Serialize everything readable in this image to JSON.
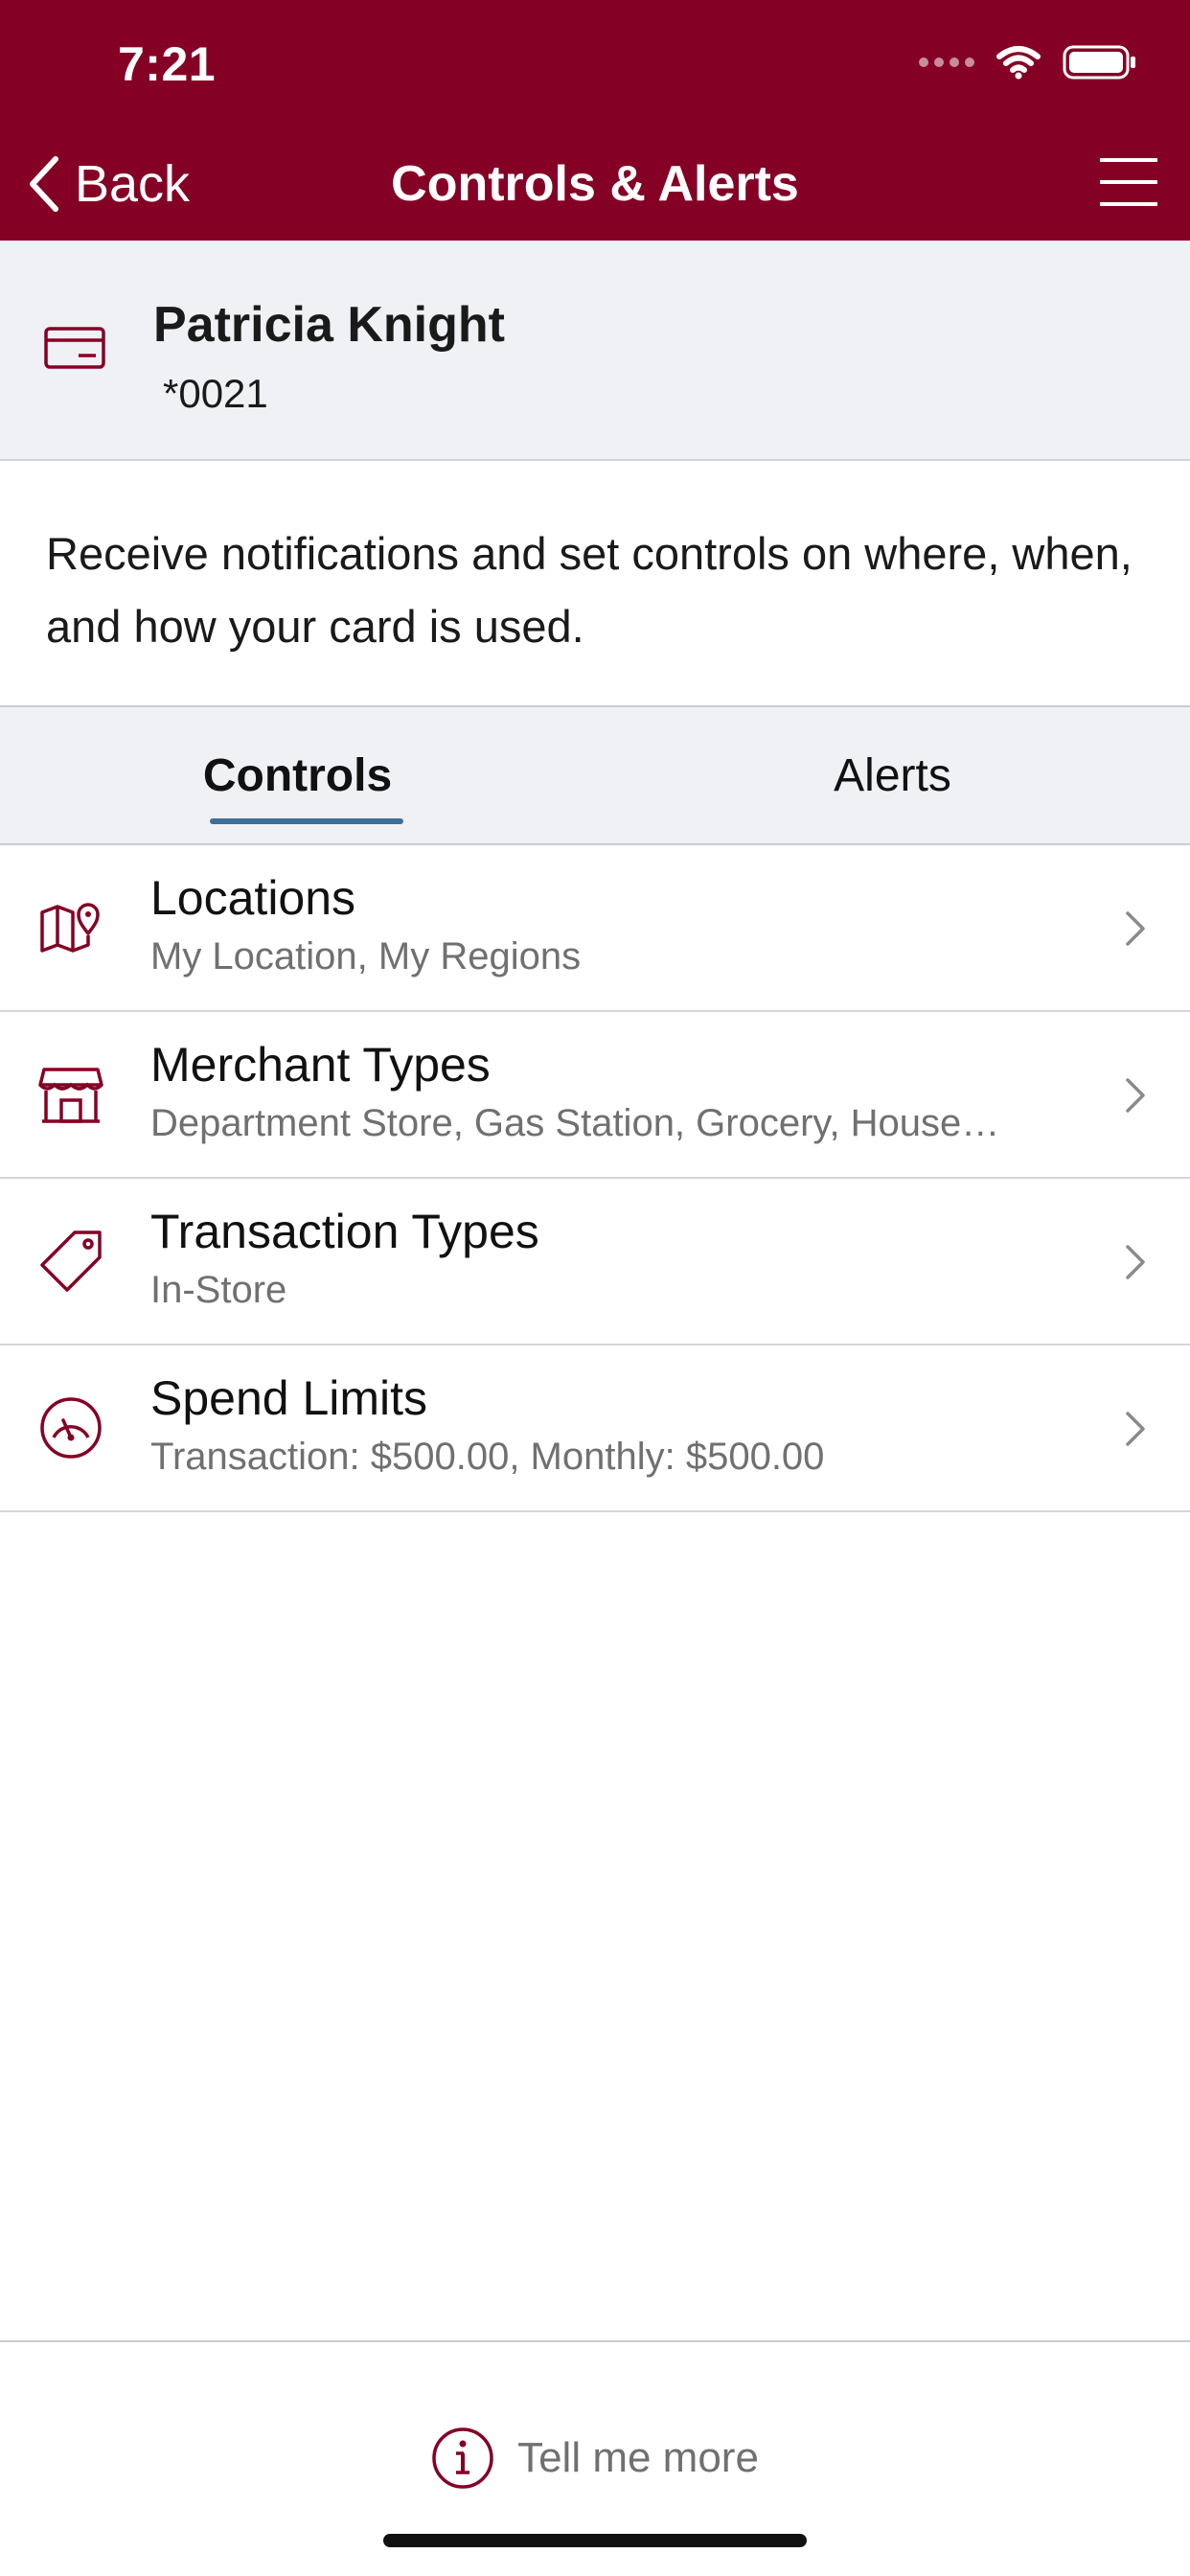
{
  "status_bar": {
    "time": "7:21",
    "icons": [
      "signal-dots-icon",
      "wifi-icon",
      "battery-icon"
    ]
  },
  "nav": {
    "back_label": "Back",
    "title": "Controls & Alerts",
    "menu_icon": "hamburger-menu-icon"
  },
  "account": {
    "icon": "credit-card-icon",
    "name": "Patricia Knight",
    "number": "*0021"
  },
  "description": "Receive notifications and set controls on where, when, and how your card is used.",
  "tabs": [
    {
      "label": "Controls",
      "active": true
    },
    {
      "label": "Alerts",
      "active": false
    }
  ],
  "items": [
    {
      "icon": "map-pin-icon",
      "title": "Locations",
      "subtitle": "My Location, My Regions"
    },
    {
      "icon": "storefront-icon",
      "title": "Merchant Types",
      "subtitle": "Department Store, Gas Station, Grocery, House…"
    },
    {
      "icon": "price-tag-icon",
      "title": "Transaction Types",
      "subtitle": "In-Store"
    },
    {
      "icon": "gauge-icon",
      "title": "Spend Limits",
      "subtitle": "Transaction: $500.00, Monthly: $500.00"
    }
  ],
  "footer": {
    "icon": "info-icon",
    "label": "Tell me more"
  },
  "colors": {
    "brand": "#850025",
    "tab_underline": "#3b6f9c",
    "panel_bg": "#eff1f4",
    "secondary_text": "#707070"
  }
}
